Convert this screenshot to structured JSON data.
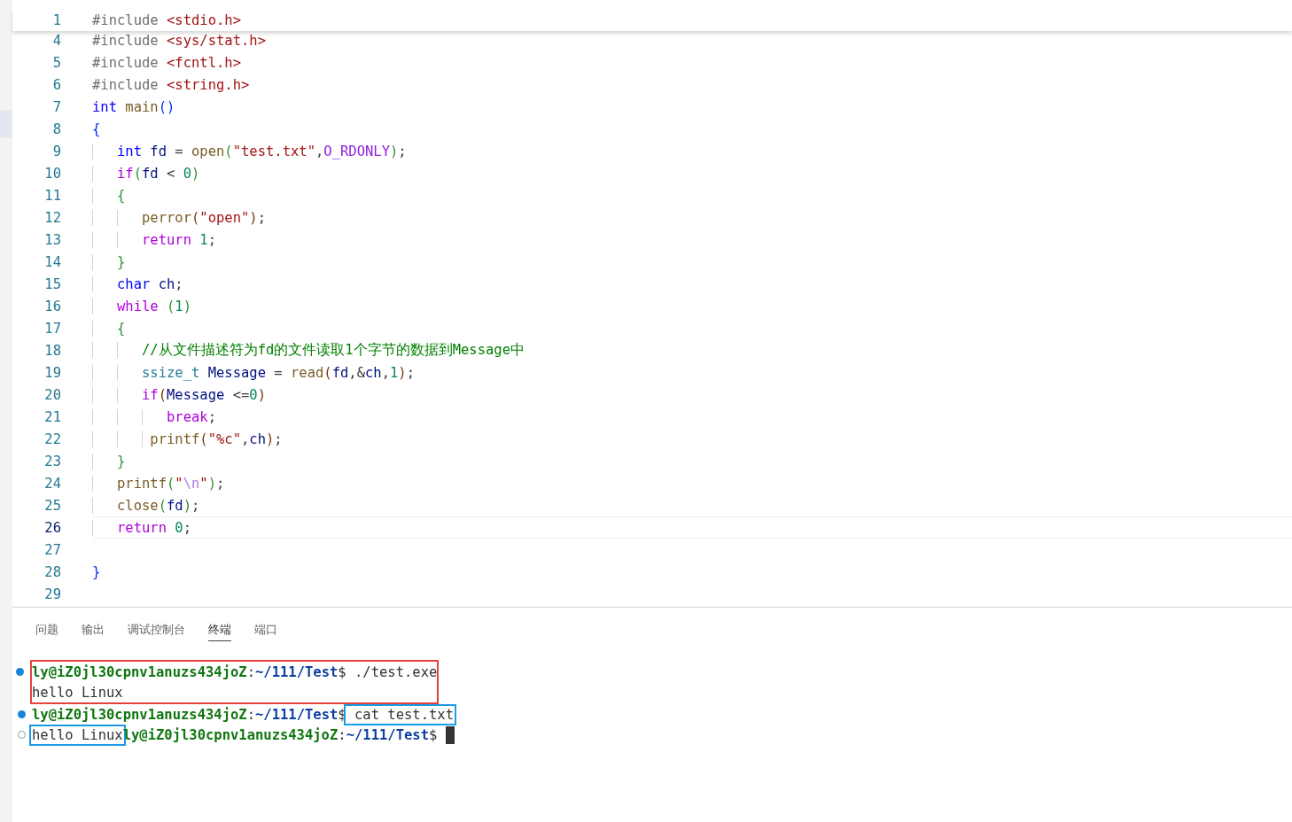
{
  "editor": {
    "sticky_line": {
      "number": "1",
      "tokens": [
        {
          "kind": "inc",
          "text": "#include "
        },
        {
          "kind": "hdr",
          "text": "<stdio.h>"
        }
      ]
    },
    "lines": [
      {
        "number": "4",
        "active": false,
        "tokens": [
          {
            "kind": "inc",
            "text": "#include "
          },
          {
            "kind": "hdr",
            "text": "<sys/stat.h>"
          }
        ]
      },
      {
        "number": "5",
        "active": false,
        "tokens": [
          {
            "kind": "inc",
            "text": "#include "
          },
          {
            "kind": "hdr",
            "text": "<fcntl.h>"
          }
        ]
      },
      {
        "number": "6",
        "active": false,
        "tokens": [
          {
            "kind": "inc",
            "text": "#include "
          },
          {
            "kind": "hdr",
            "text": "<string.h>"
          }
        ]
      },
      {
        "number": "7",
        "active": false,
        "tokens": [
          {
            "kind": "kw",
            "text": "int "
          },
          {
            "kind": "fn",
            "text": "main"
          },
          {
            "kind": "b1",
            "text": "()"
          }
        ]
      },
      {
        "number": "8",
        "active": false,
        "tokens": [
          {
            "kind": "b1",
            "text": "{"
          }
        ]
      },
      {
        "number": "9",
        "active": false,
        "tokens": [
          {
            "kind": "kw",
            "text": "   int "
          },
          {
            "kind": "var",
            "text": "fd"
          },
          {
            "kind": "p",
            "text": " = "
          },
          {
            "kind": "fn",
            "text": "open"
          },
          {
            "kind": "b2",
            "text": "("
          },
          {
            "kind": "str",
            "text": "\"test.txt\""
          },
          {
            "kind": "p",
            "text": ","
          },
          {
            "kind": "mac",
            "text": "O_RDONLY"
          },
          {
            "kind": "b2",
            "text": ")"
          },
          {
            "kind": "p",
            "text": ";"
          }
        ]
      },
      {
        "number": "10",
        "active": false,
        "tokens": [
          {
            "kind": "ctl",
            "text": "   if"
          },
          {
            "kind": "b2",
            "text": "("
          },
          {
            "kind": "var",
            "text": "fd"
          },
          {
            "kind": "p",
            "text": " < "
          },
          {
            "kind": "num",
            "text": "0"
          },
          {
            "kind": "b2",
            "text": ")"
          }
        ]
      },
      {
        "number": "11",
        "active": false,
        "tokens": [
          {
            "kind": "b2",
            "text": "   {"
          }
        ]
      },
      {
        "number": "12",
        "active": false,
        "tokens": [
          {
            "kind": "fn",
            "text": "      perror"
          },
          {
            "kind": "b3",
            "text": "("
          },
          {
            "kind": "str",
            "text": "\"open\""
          },
          {
            "kind": "b3",
            "text": ")"
          },
          {
            "kind": "p",
            "text": ";"
          }
        ]
      },
      {
        "number": "13",
        "active": false,
        "tokens": [
          {
            "kind": "ctl",
            "text": "      return "
          },
          {
            "kind": "num",
            "text": "1"
          },
          {
            "kind": "p",
            "text": ";"
          }
        ]
      },
      {
        "number": "14",
        "active": false,
        "tokens": [
          {
            "kind": "b2",
            "text": "   }"
          }
        ]
      },
      {
        "number": "15",
        "active": false,
        "tokens": [
          {
            "kind": "kw",
            "text": "   char "
          },
          {
            "kind": "var",
            "text": "ch"
          },
          {
            "kind": "p",
            "text": ";"
          }
        ]
      },
      {
        "number": "16",
        "active": false,
        "tokens": [
          {
            "kind": "ctl",
            "text": "   while "
          },
          {
            "kind": "b2",
            "text": "("
          },
          {
            "kind": "num",
            "text": "1"
          },
          {
            "kind": "b2",
            "text": ")"
          }
        ]
      },
      {
        "number": "17",
        "active": false,
        "tokens": [
          {
            "kind": "b2",
            "text": "   {"
          }
        ]
      },
      {
        "number": "18",
        "active": false,
        "tokens": [
          {
            "kind": "cmt",
            "text": "      //从文件描述符为fd的文件读取1个字节的数据到Message中"
          }
        ]
      },
      {
        "number": "19",
        "active": false,
        "tokens": [
          {
            "kind": "type",
            "text": "      ssize_t "
          },
          {
            "kind": "var",
            "text": "Message"
          },
          {
            "kind": "p",
            "text": " = "
          },
          {
            "kind": "fn",
            "text": "read"
          },
          {
            "kind": "b3",
            "text": "("
          },
          {
            "kind": "var",
            "text": "fd"
          },
          {
            "kind": "p",
            "text": ",&"
          },
          {
            "kind": "var",
            "text": "ch"
          },
          {
            "kind": "p",
            "text": ","
          },
          {
            "kind": "num",
            "text": "1"
          },
          {
            "kind": "b3",
            "text": ")"
          },
          {
            "kind": "p",
            "text": ";"
          }
        ]
      },
      {
        "number": "20",
        "active": false,
        "tokens": [
          {
            "kind": "ctl",
            "text": "      if"
          },
          {
            "kind": "b3",
            "text": "("
          },
          {
            "kind": "var",
            "text": "Message"
          },
          {
            "kind": "p",
            "text": " <="
          },
          {
            "kind": "num",
            "text": "0"
          },
          {
            "kind": "b3",
            "text": ")"
          }
        ]
      },
      {
        "number": "21",
        "active": false,
        "tokens": [
          {
            "kind": "ctl",
            "text": "         break"
          },
          {
            "kind": "p",
            "text": ";"
          }
        ]
      },
      {
        "number": "22",
        "active": false,
        "tokens": [
          {
            "kind": "fn",
            "text": "       printf"
          },
          {
            "kind": "b3",
            "text": "("
          },
          {
            "kind": "str",
            "text": "\"%c\""
          },
          {
            "kind": "p",
            "text": ","
          },
          {
            "kind": "var",
            "text": "ch"
          },
          {
            "kind": "b3",
            "text": ")"
          },
          {
            "kind": "p",
            "text": ";"
          }
        ]
      },
      {
        "number": "23",
        "active": false,
        "tokens": [
          {
            "kind": "b2",
            "text": "   }"
          }
        ]
      },
      {
        "number": "24",
        "active": false,
        "tokens": [
          {
            "kind": "fn",
            "text": "   printf"
          },
          {
            "kind": "b2",
            "text": "("
          },
          {
            "kind": "str",
            "text": "\""
          },
          {
            "kind": "esc",
            "text": "\\n"
          },
          {
            "kind": "str",
            "text": "\""
          },
          {
            "kind": "b2",
            "text": ")"
          },
          {
            "kind": "p",
            "text": ";"
          }
        ]
      },
      {
        "number": "25",
        "active": false,
        "tokens": [
          {
            "kind": "fn",
            "text": "   close"
          },
          {
            "kind": "b2",
            "text": "("
          },
          {
            "kind": "var",
            "text": "fd"
          },
          {
            "kind": "b2",
            "text": ")"
          },
          {
            "kind": "p",
            "text": ";"
          }
        ]
      },
      {
        "number": "26",
        "active": true,
        "tokens": [
          {
            "kind": "ctl",
            "text": "   return "
          },
          {
            "kind": "num",
            "text": "0"
          },
          {
            "kind": "p",
            "text": ";"
          }
        ]
      },
      {
        "number": "27",
        "active": false
      },
      {
        "number": "28",
        "active": false,
        "tokens": [
          {
            "kind": "b1",
            "text": "}"
          }
        ]
      },
      {
        "number": "29",
        "active": false
      }
    ]
  },
  "panel": {
    "tabs": [
      {
        "label": "问题",
        "selected": false
      },
      {
        "label": "输出",
        "selected": false
      },
      {
        "label": "调试控制台",
        "selected": false
      },
      {
        "label": "终端",
        "selected": true
      },
      {
        "label": "端口",
        "selected": false
      }
    ],
    "terminal": [
      {
        "color": "#e8403d",
        "lines": [
          {
            "kind": "filled",
            "segments": [
              {
                "kind": "user",
                "text": "ly@iZ0jl30cpnv1anuzs434joZ"
              },
              {
                "kind": "plain",
                "text": ":"
              },
              {
                "kind": "path",
                "text": "~/111/Test"
              },
              {
                "kind": "plain",
                "text": "$ ./test.exe"
              }
            ]
          },
          {
            "kind": "none",
            "segments": [
              {
                "kind": "plain",
                "text": "hello Linux"
              }
            ]
          }
        ]
      },
      {
        "lines": [
          {
            "kind": "filled",
            "segments": [
              {
                "kind": "user",
                "text": "ly@iZ0jl30cpnv1anuzs434joZ"
              },
              {
                "kind": "plain",
                "text": ":"
              },
              {
                "kind": "path",
                "text": "~/111/Test"
              },
              {
                "kind": "plain",
                "text": "$"
              },
              {
                "kind": "plain",
                "text": " cat test.txt",
                "color": "#1a9be8"
              }
            ]
          },
          {
            "kind": "hollow",
            "cursor": true,
            "segments": [
              {
                "kind": "plain",
                "text": "hello Linux",
                "color": "#1a9be8"
              },
              {
                "kind": "user",
                "text": "ly@iZ0jl30cpnv1anuzs434joZ"
              },
              {
                "kind": "plain",
                "text": ":"
              },
              {
                "kind": "path",
                "text": "~/111/Test"
              },
              {
                "kind": "plain",
                "text": "$"
              }
            ]
          }
        ]
      }
    ]
  }
}
